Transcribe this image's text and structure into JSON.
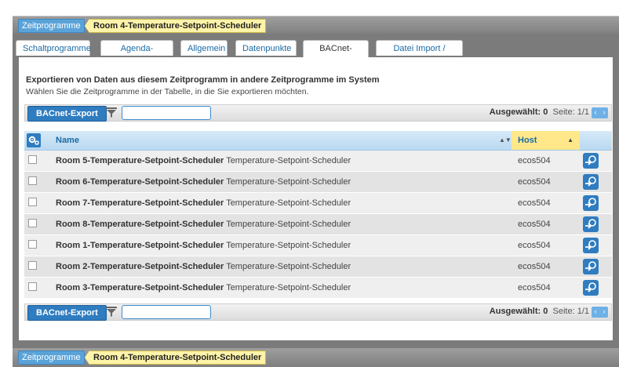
{
  "breadcrumb": {
    "program_label": "Zeitprogramme",
    "current_name": "Room 4-Temperature-Setpoint-Scheduler"
  },
  "tabs": [
    {
      "label": "Schaltprogramme"
    },
    {
      "label": "Agenda-Ansicht"
    },
    {
      "label": "Allgemein"
    },
    {
      "label": "Datenpunkte"
    },
    {
      "label": "BACnet-Export",
      "active": true
    },
    {
      "label": "Datei Import / Export"
    }
  ],
  "main": {
    "heading": "Exportieren von Daten aus diesem Zeitprogramm in andere Zeitprogramme im System",
    "subheading": "Wählen Sie die Zeitprogramme in der Tabelle, in die Sie exportieren möchten."
  },
  "toolbar": {
    "export_label": "BACnet-Export",
    "search_value": "",
    "selected_label": "Ausgewählt:",
    "selected_count": "0",
    "page_label": "Seite:",
    "page_value": "1/1",
    "prev_icon": "‹",
    "next_icon": "›"
  },
  "table": {
    "col_name": "Name",
    "col_host": "Host",
    "rows": [
      {
        "name": "Room 5-Temperature-Setpoint-Scheduler",
        "type": "Temperature-Setpoint-Scheduler",
        "host": "ecos504"
      },
      {
        "name": "Room 6-Temperature-Setpoint-Scheduler",
        "type": "Temperature-Setpoint-Scheduler",
        "host": "ecos504"
      },
      {
        "name": "Room 7-Temperature-Setpoint-Scheduler",
        "type": "Temperature-Setpoint-Scheduler",
        "host": "ecos504"
      },
      {
        "name": "Room 8-Temperature-Setpoint-Scheduler",
        "type": "Temperature-Setpoint-Scheduler",
        "host": "ecos504"
      },
      {
        "name": "Room 1-Temperature-Setpoint-Scheduler",
        "type": "Temperature-Setpoint-Scheduler",
        "host": "ecos504"
      },
      {
        "name": "Room 2-Temperature-Setpoint-Scheduler",
        "type": "Temperature-Setpoint-Scheduler",
        "host": "ecos504"
      },
      {
        "name": "Room 3-Temperature-Setpoint-Scheduler",
        "type": "Temperature-Setpoint-Scheduler",
        "host": "ecos504"
      }
    ]
  },
  "colors": {
    "accent": "#2f7cc0",
    "header_bar": "#8c8c8c",
    "crumb_current": "#fff3a8",
    "sorted_column": "#ffe88a"
  },
  "icons": {
    "gear": "gear-menu-icon",
    "filter": "filter-icon",
    "row_action": "export-arrow-icon"
  }
}
